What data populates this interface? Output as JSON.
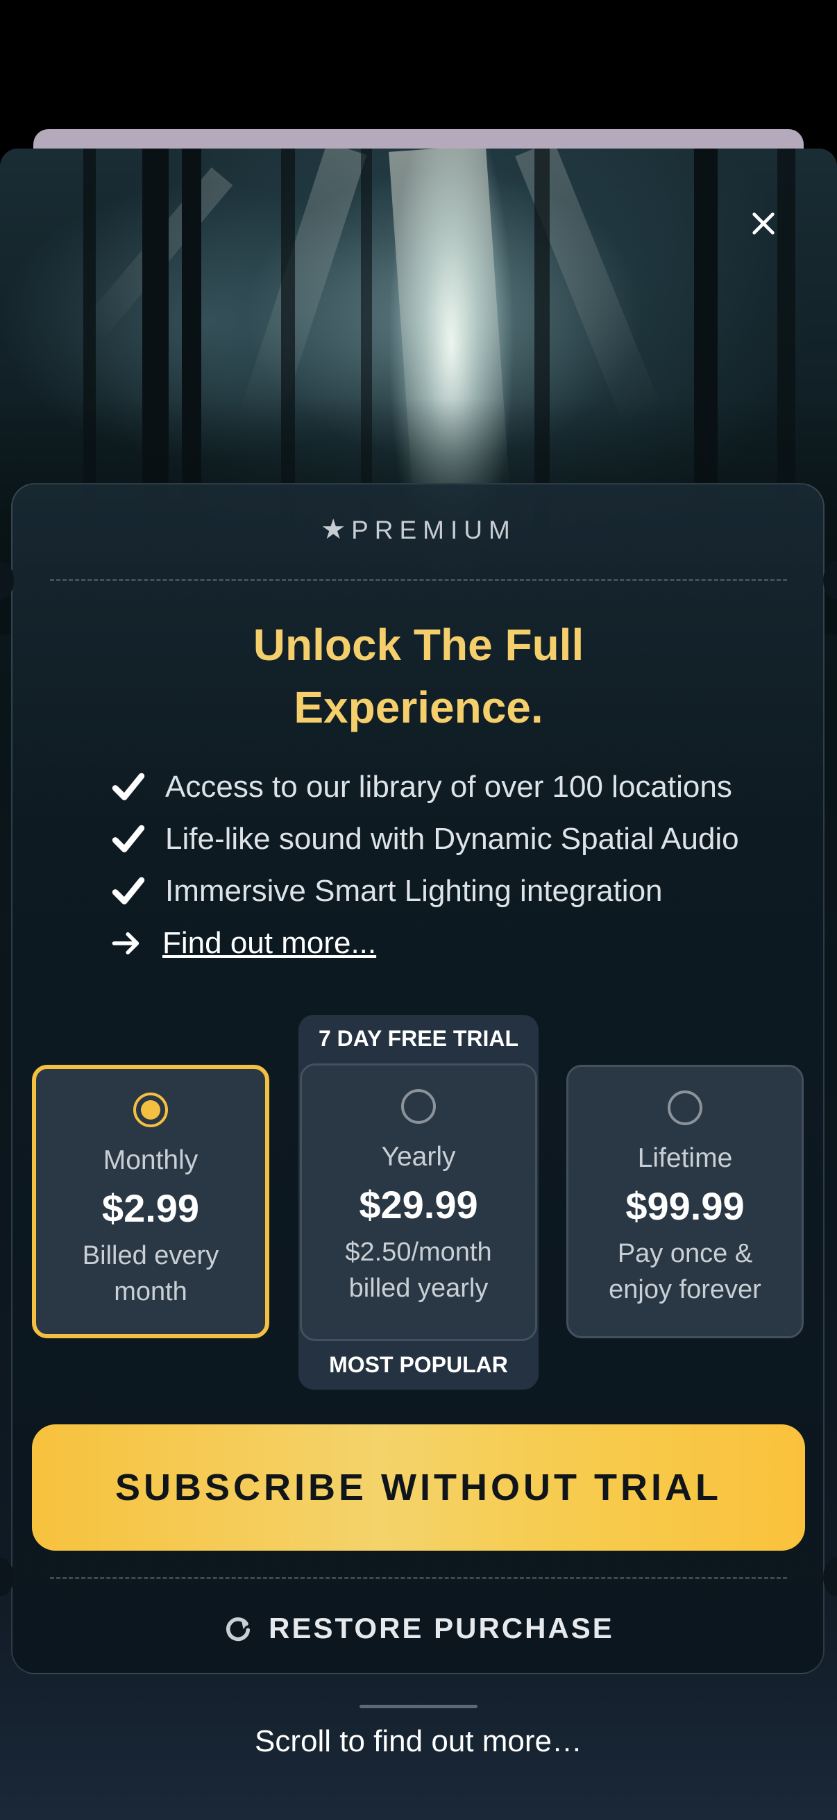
{
  "paywall": {
    "badge": "PREMIUM",
    "headline_line1": "Unlock The Full",
    "headline_line2": "Experience.",
    "features": [
      "Access to our library of over 100 locations",
      "Life-like sound with Dynamic Spatial Audio",
      "Immersive Smart Lighting integration"
    ],
    "find_out_more": "Find out more...",
    "plans": [
      {
        "name": "Monthly",
        "price": "$2.99",
        "sub1": "Billed every",
        "sub2": "month",
        "selected": true
      },
      {
        "name": "Yearly",
        "price": "$29.99",
        "sub1": "$2.50/month",
        "sub2": "billed yearly",
        "selected": false
      },
      {
        "name": "Lifetime",
        "price": "$99.99",
        "sub1": "Pay once &",
        "sub2": "enjoy forever",
        "selected": false
      }
    ],
    "trial_label": "7 DAY FREE TRIAL",
    "popular_label": "MOST POPULAR",
    "subscribe_button": "SUBSCRIBE WITHOUT TRIAL",
    "restore_button": "RESTORE PURCHASE",
    "scroll_hint": "Scroll to find out more…"
  },
  "icons": {
    "close": "close-icon",
    "star": "star-icon",
    "check": "check-icon",
    "arrow": "arrow-right-icon",
    "restore": "refresh-icon"
  },
  "colors": {
    "accent": "#f4c042",
    "headline": "#f5cf6b",
    "card_bg": "#0e1a22"
  }
}
